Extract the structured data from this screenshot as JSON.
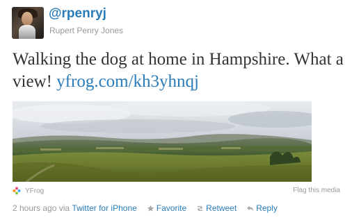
{
  "user": {
    "handle": "@rpenryj",
    "full_name": "Rupert Penry Jones"
  },
  "tweet": {
    "text": "Walking the dog at home in Hampshire. What a view!",
    "link": "yfrog.com/kh3yhnqj"
  },
  "media": {
    "source": "YFrog",
    "flag": "Flag this media"
  },
  "meta": {
    "time": "2 hours ago",
    "via": "via",
    "client": "Twitter for iPhone"
  },
  "actions": {
    "favorite": "Favorite",
    "retweet": "Retweet",
    "reply": "Reply"
  },
  "colors": {
    "link": "#2a7cb9",
    "muted": "#999999",
    "text": "#333333"
  }
}
